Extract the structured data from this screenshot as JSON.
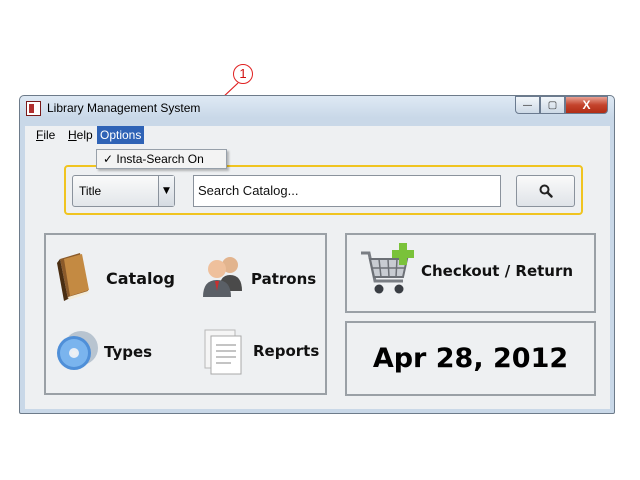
{
  "annotation": {
    "number": "1"
  },
  "window": {
    "title": "Library Management System",
    "buttons": {
      "minimize": "—",
      "maximize": "▢",
      "close": "X"
    }
  },
  "menubar": {
    "items": [
      {
        "label_first": "F",
        "label_rest": "ile"
      },
      {
        "label_first": "H",
        "label_rest": "elp"
      },
      {
        "label": "Options"
      }
    ]
  },
  "options_menu": {
    "item_check": "✓",
    "item_label": "Insta-Search On"
  },
  "search": {
    "type_value": "Title",
    "placeholder": "Search Catalog...",
    "input_value": "Search Catalog..."
  },
  "tiles": {
    "catalog": "Catalog",
    "patrons": "Patrons",
    "types": "Types",
    "reports": "Reports",
    "checkout": "Checkout / Return"
  },
  "date": "Apr 28, 2012",
  "colors": {
    "accent": "#f0c420",
    "menu_active": "#2f63b6",
    "annotation": "#e02020"
  }
}
